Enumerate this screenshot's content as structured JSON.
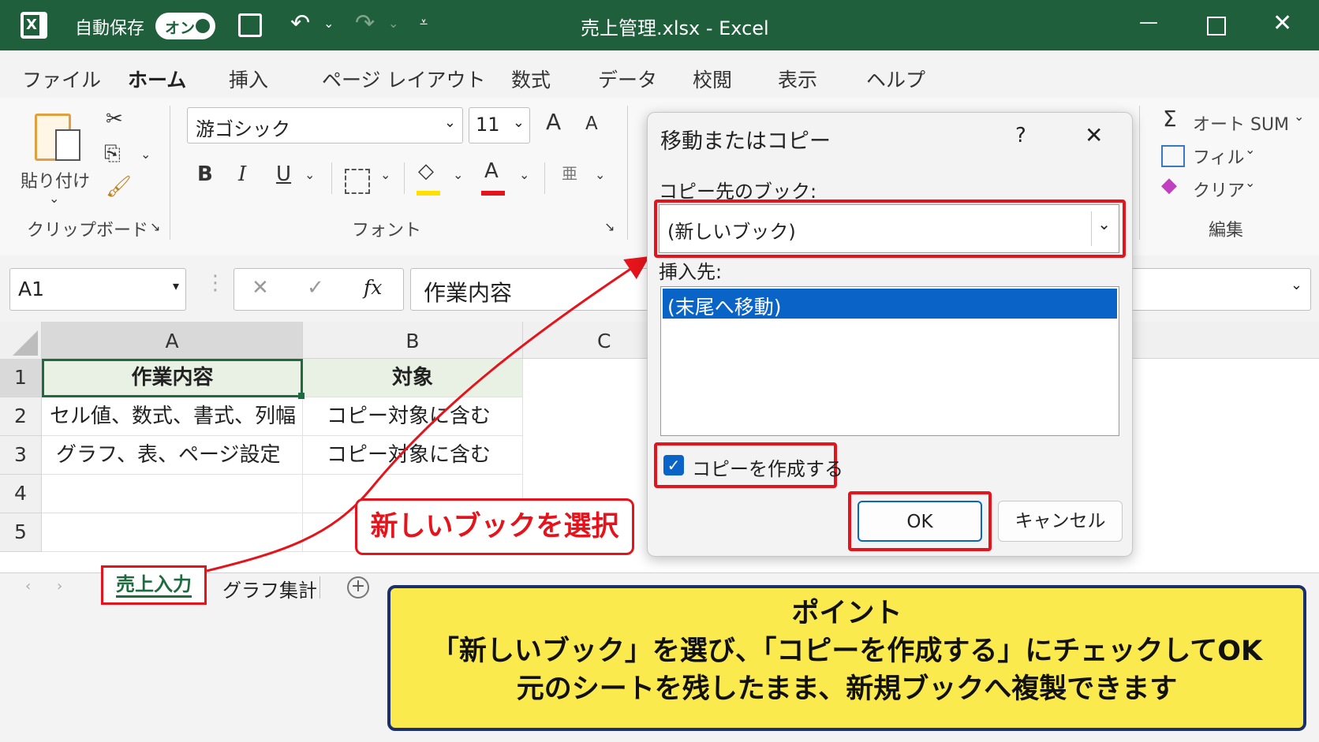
{
  "titlebar": {
    "autosave_label": "自動保存",
    "autosave_state": "オン",
    "title": "売上管理.xlsx  -  Excel"
  },
  "menu_tabs": [
    "ファイル",
    "ホーム",
    "挿入",
    "ページ レイアウト",
    "数式",
    "データ",
    "校閲",
    "表示",
    "ヘルプ"
  ],
  "active_tab": "ホーム",
  "ribbon": {
    "paste_label": "貼り付け",
    "clipboard_group": "クリップボード",
    "font_name": "游ゴシック",
    "font_size": "11",
    "grow_font": "A",
    "shrink_font": "A",
    "bold": "B",
    "italic": "I",
    "underline": "U",
    "font_color": "A",
    "font_group": "フォント",
    "autosum": "オート SUM",
    "fill": "フィル",
    "clear": "クリア",
    "edit_group": "編集"
  },
  "formula_bar": {
    "name_box": "A1",
    "fx": "fx",
    "content": "作業内容"
  },
  "grid": {
    "columns": [
      "A",
      "B",
      "C"
    ],
    "rows": [
      "1",
      "2",
      "3",
      "4",
      "5"
    ],
    "cells": [
      [
        "作業内容",
        "対象"
      ],
      [
        "セル値、数式、書式、列幅",
        "コピー対象に含む"
      ],
      [
        "グラフ、表、ページ設定",
        "コピー対象に含む"
      ]
    ]
  },
  "sheet_tabs": {
    "active": "売上入力",
    "other": "グラフ集計",
    "add": "+"
  },
  "dialog": {
    "title": "移動またはコピー",
    "help": "?",
    "close": "✕",
    "dest_book_label": "コピー先のブック:",
    "dest_book_value": "(新しいブック)",
    "insert_before_label": "挿入先:",
    "insert_before_items": [
      "(末尾へ移動)"
    ],
    "copy_checkbox_label": "コピーを作成する",
    "copy_checked": true,
    "ok": "OK",
    "cancel": "キャンセル"
  },
  "annotations": {
    "callout": "新しいブックを選択",
    "note_title": "ポイント",
    "note_line1": "「新しいブック」を選び、「コピーを作成する」にチェックしてOK",
    "note_line2": "元のシートを残したまま、新規ブックへ複製できます"
  },
  "colors": {
    "excel_green": "#1f5f3c",
    "highlight_red": "#e5141c",
    "note_yellow": "#fbea4e",
    "selection_blue": "#0a64c8"
  }
}
